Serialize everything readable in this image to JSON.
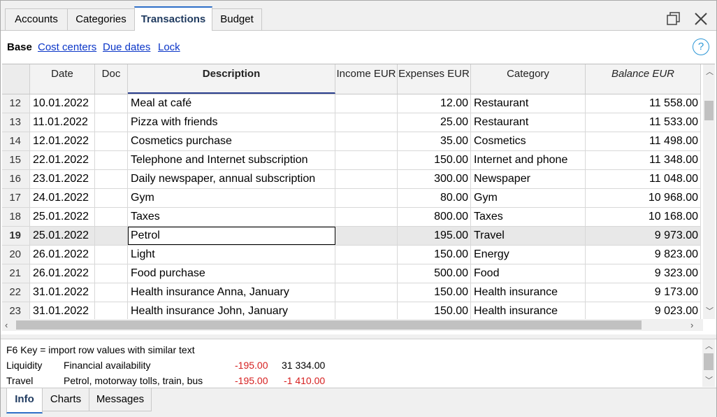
{
  "tabs": [
    "Accounts",
    "Categories",
    "Transactions",
    "Budget"
  ],
  "active_tab": "Transactions",
  "subnav": {
    "base": "Base",
    "links": [
      "Cost centers",
      "Due dates",
      "Lock"
    ],
    "help": "?"
  },
  "columns": [
    "Date",
    "Doc",
    "Description",
    "Income EUR",
    "Expenses EUR",
    "Category",
    "Balance EUR"
  ],
  "rows": [
    {
      "n": "12",
      "date": "10.01.2022",
      "doc": "",
      "desc": "Meal at café",
      "inc": "",
      "exp": "12.00",
      "cat": "Restaurant",
      "bal": "11 558.00"
    },
    {
      "n": "13",
      "date": "11.01.2022",
      "doc": "",
      "desc": "Pizza with friends",
      "inc": "",
      "exp": "25.00",
      "cat": "Restaurant",
      "bal": "11 533.00"
    },
    {
      "n": "14",
      "date": "12.01.2022",
      "doc": "",
      "desc": "Cosmetics purchase",
      "inc": "",
      "exp": "35.00",
      "cat": "Cosmetics",
      "bal": "11 498.00"
    },
    {
      "n": "15",
      "date": "22.01.2022",
      "doc": "",
      "desc": "Telephone and Internet subscription",
      "inc": "",
      "exp": "150.00",
      "cat": "Internet and phone",
      "bal": "11 348.00"
    },
    {
      "n": "16",
      "date": "23.01.2022",
      "doc": "",
      "desc": "Daily newspaper, annual subscription",
      "inc": "",
      "exp": "300.00",
      "cat": "Newspaper",
      "bal": "11 048.00"
    },
    {
      "n": "17",
      "date": "24.01.2022",
      "doc": "",
      "desc": "Gym",
      "inc": "",
      "exp": "80.00",
      "cat": "Gym",
      "bal": "10 968.00"
    },
    {
      "n": "18",
      "date": "25.01.2022",
      "doc": "",
      "desc": "Taxes",
      "inc": "",
      "exp": "800.00",
      "cat": "Taxes",
      "bal": "10 168.00"
    },
    {
      "n": "19",
      "date": "25.01.2022",
      "doc": "",
      "desc": "Petrol",
      "inc": "",
      "exp": "195.00",
      "cat": "Travel",
      "bal": "9 973.00"
    },
    {
      "n": "20",
      "date": "26.01.2022",
      "doc": "",
      "desc": "Light",
      "inc": "",
      "exp": "150.00",
      "cat": "Energy",
      "bal": "9 823.00"
    },
    {
      "n": "21",
      "date": "26.01.2022",
      "doc": "",
      "desc": "Food purchase",
      "inc": "",
      "exp": "500.00",
      "cat": "Food",
      "bal": "9 323.00"
    },
    {
      "n": "22",
      "date": "31.01.2022",
      "doc": "",
      "desc": "Health insurance Anna, January",
      "inc": "",
      "exp": "150.00",
      "cat": "Health insurance",
      "bal": "9 173.00"
    },
    {
      "n": "23",
      "date": "31.01.2022",
      "doc": "",
      "desc": "Health insurance John, January",
      "inc": "",
      "exp": "150.00",
      "cat": "Health insurance",
      "bal": "9 023.00"
    }
  ],
  "selected_row": "19",
  "info": {
    "hint": "F6 Key = import row values with similar text",
    "lines": [
      {
        "account": "Liquidity",
        "description": "Financial availability",
        "amount": "-195.00",
        "total": "31 334.00"
      },
      {
        "account": "Travel",
        "description": "Petrol, motorway tolls, train, bus",
        "amount": "-195.00",
        "total": "-1 410.00"
      }
    ]
  },
  "bottom_tabs": [
    "Info",
    "Charts",
    "Messages"
  ],
  "active_bottom_tab": "Info",
  "colors": {
    "accent": "#2e6fc8",
    "link": "#0b36c8",
    "negative": "#d62020",
    "help": "#2d97d6"
  }
}
